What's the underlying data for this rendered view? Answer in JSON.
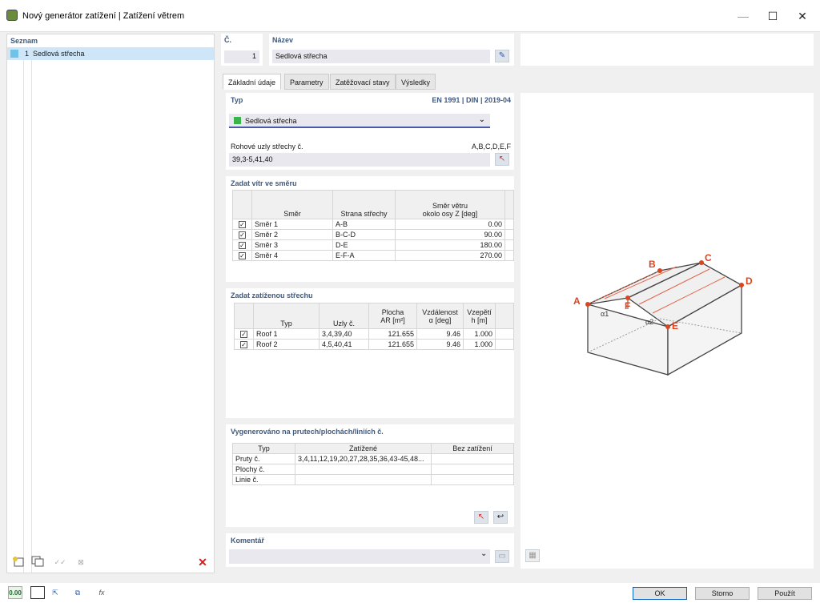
{
  "window": {
    "title": "Nový generátor zatížení | Zatížení větrem"
  },
  "list": {
    "header": "Seznam",
    "items": [
      {
        "no": "1",
        "label": "Sedlová střecha"
      }
    ]
  },
  "header": {
    "no_label": "Č.",
    "no_value": "1",
    "name_label": "Název",
    "name_value": "Sedlová střecha"
  },
  "tabs": [
    "Základní údaje",
    "Parametry",
    "Zatěžovací stavy",
    "Výsledky"
  ],
  "typ": {
    "label": "Typ",
    "standard": "EN 1991 | DIN | 2019-04",
    "value": "Sedlová střecha",
    "color": "#3cb34a",
    "corner_label": "Rohové uzly střechy č.",
    "corner_hint": "A,B,C,D,E,F",
    "corner_value": "39,3-5,41,40"
  },
  "wind": {
    "header": "Zadat vítr ve směru",
    "col_dir": "Směr",
    "col_side": "Strana střechy",
    "col_angle_1": "Směr větru",
    "col_angle_2": "okolo osy Z [deg]",
    "rows": [
      {
        "dir": "Směr 1",
        "side": "A-B",
        "angle": "0.00"
      },
      {
        "dir": "Směr 2",
        "side": "B-C-D",
        "angle": "90.00"
      },
      {
        "dir": "Směr 3",
        "side": "D-E",
        "angle": "180.00"
      },
      {
        "dir": "Směr 4",
        "side": "E-F-A",
        "angle": "270.00"
      }
    ]
  },
  "roof": {
    "header": "Zadat zatíženou střechu",
    "col_type": "Typ",
    "col_nodes": "Uzly č.",
    "col_area_1": "Plocha",
    "col_area_2": "AR [m²]",
    "col_dist_1": "Vzdálenost",
    "col_dist_2": "α [deg]",
    "col_h_1": "Vzepětí",
    "col_h_2": "h [m]",
    "rows": [
      {
        "type": "Roof 1",
        "nodes": "3,4,39,40",
        "area": "121.655",
        "alpha": "9.46",
        "h": "1.000"
      },
      {
        "type": "Roof 2",
        "nodes": "4,5,40,41",
        "area": "121.655",
        "alpha": "9.46",
        "h": "1.000"
      }
    ]
  },
  "generated": {
    "header": "Vygenerováno na prutech/plochách/liniích č.",
    "col_type": "Typ",
    "col_load": "Zatížené",
    "col_noload": "Bez zatížení",
    "rows": [
      {
        "type": "Pruty č.",
        "load": "3,4,11,12,19,20,27,28,35,36,43-45,48...",
        "noload": ""
      },
      {
        "type": "Plochy č.",
        "load": "",
        "noload": ""
      },
      {
        "type": "Linie č.",
        "load": "",
        "noload": ""
      }
    ]
  },
  "comment": {
    "label": "Komentář",
    "value": ""
  },
  "diagram": {
    "labels": {
      "a": "A",
      "b": "B",
      "c": "C",
      "d": "D",
      "e": "E",
      "f": "F",
      "alpha1": "α1",
      "alpha2": "α2"
    },
    "accent": "#d9451f"
  },
  "buttons": {
    "ok": "OK",
    "cancel": "Storno",
    "apply": "Použít"
  }
}
